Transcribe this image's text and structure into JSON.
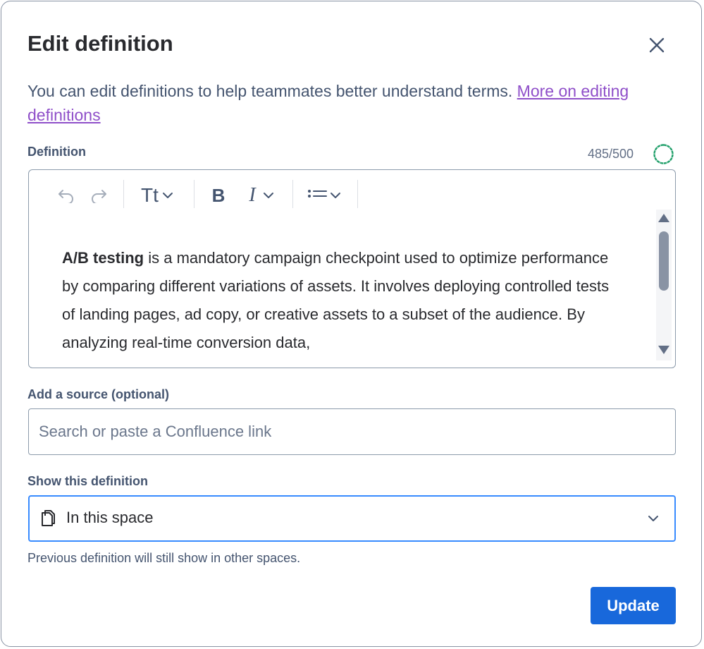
{
  "dialog": {
    "title": "Edit definition",
    "close_icon": "close-icon",
    "intro_text": "You can edit definitions to help teammates better understand terms. ",
    "intro_link": "More on editing definitions"
  },
  "definition": {
    "label": "Definition",
    "char_count": "485/500",
    "progress_fraction": 0.97,
    "progress_color": "#22a06b",
    "toolbar": {
      "undo_icon": "undo-icon",
      "redo_icon": "redo-icon",
      "text_style_icon": "text-style-icon",
      "text_style_label": "Tt",
      "bold_icon": "bold-icon",
      "bold_label": "B",
      "italic_icon": "italic-icon",
      "italic_label": "I",
      "list_icon": "list-icon"
    },
    "content_bold": "A/B testing",
    "content_rest": " is a mandatory campaign checkpoint used to optimize performance by comparing different variations of assets. It involves deploying controlled tests of landing pages, ad copy, or creative assets to a subset of the audience. By analyzing real-time conversion data,"
  },
  "source": {
    "label": "Add a source (optional)",
    "placeholder": "Search or paste a Confluence link",
    "value": ""
  },
  "visibility": {
    "label": "Show this definition",
    "icon": "page-icon",
    "selected": "In this space",
    "helper": "Previous definition will still show in other spaces."
  },
  "actions": {
    "update_label": "Update",
    "accent": "#1868db"
  }
}
